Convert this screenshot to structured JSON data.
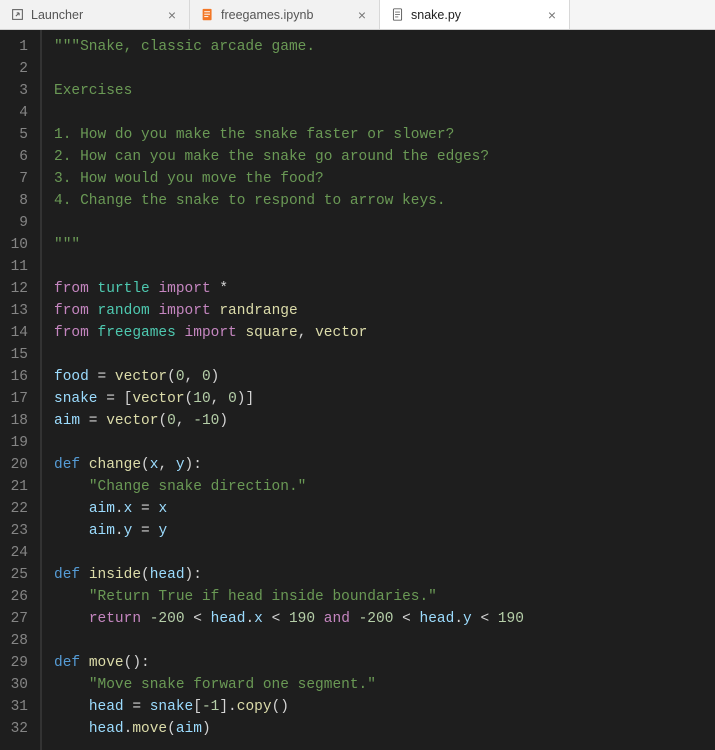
{
  "tabs": [
    {
      "icon": "launcher-icon",
      "label": "Launcher",
      "active": false
    },
    {
      "icon": "notebook-icon",
      "label": "freegames.ipynb",
      "active": false
    },
    {
      "icon": "python-file-icon",
      "label": "snake.py",
      "active": true
    }
  ],
  "editor": {
    "line_numbers": [
      "1",
      "2",
      "3",
      "4",
      "5",
      "6",
      "7",
      "8",
      "9",
      "10",
      "11",
      "12",
      "13",
      "14",
      "15",
      "16",
      "17",
      "18",
      "19",
      "20",
      "21",
      "22",
      "23",
      "24",
      "25",
      "26",
      "27",
      "28",
      "29",
      "30",
      "31",
      "32"
    ],
    "lines": [
      [
        {
          "t": "str",
          "v": "\"\"\"Snake, classic arcade game."
        }
      ],
      [],
      [
        {
          "t": "str",
          "v": "Exercises"
        }
      ],
      [],
      [
        {
          "t": "str",
          "v": "1. How do you make the snake faster or slower?"
        }
      ],
      [
        {
          "t": "str",
          "v": "2. How can you make the snake go around the edges?"
        }
      ],
      [
        {
          "t": "str",
          "v": "3. How would you move the food?"
        }
      ],
      [
        {
          "t": "str",
          "v": "4. Change the snake to respond to arrow keys."
        }
      ],
      [],
      [
        {
          "t": "str",
          "v": "\"\"\""
        }
      ],
      [],
      [
        {
          "t": "kw",
          "v": "from"
        },
        {
          "t": "op",
          "v": " "
        },
        {
          "t": "mod",
          "v": "turtle"
        },
        {
          "t": "op",
          "v": " "
        },
        {
          "t": "kw",
          "v": "import"
        },
        {
          "t": "op",
          "v": " *"
        }
      ],
      [
        {
          "t": "kw",
          "v": "from"
        },
        {
          "t": "op",
          "v": " "
        },
        {
          "t": "mod",
          "v": "random"
        },
        {
          "t": "op",
          "v": " "
        },
        {
          "t": "kw",
          "v": "import"
        },
        {
          "t": "op",
          "v": " "
        },
        {
          "t": "fn",
          "v": "randrange"
        }
      ],
      [
        {
          "t": "kw",
          "v": "from"
        },
        {
          "t": "op",
          "v": " "
        },
        {
          "t": "mod",
          "v": "freegames"
        },
        {
          "t": "op",
          "v": " "
        },
        {
          "t": "kw",
          "v": "import"
        },
        {
          "t": "op",
          "v": " "
        },
        {
          "t": "fn",
          "v": "square"
        },
        {
          "t": "op",
          "v": ", "
        },
        {
          "t": "fn",
          "v": "vector"
        }
      ],
      [],
      [
        {
          "t": "var",
          "v": "food"
        },
        {
          "t": "op",
          "v": " = "
        },
        {
          "t": "fn",
          "v": "vector"
        },
        {
          "t": "op",
          "v": "("
        },
        {
          "t": "num",
          "v": "0"
        },
        {
          "t": "op",
          "v": ", "
        },
        {
          "t": "num",
          "v": "0"
        },
        {
          "t": "op",
          "v": ")"
        }
      ],
      [
        {
          "t": "var",
          "v": "snake"
        },
        {
          "t": "op",
          "v": " = ["
        },
        {
          "t": "fn",
          "v": "vector"
        },
        {
          "t": "op",
          "v": "("
        },
        {
          "t": "num",
          "v": "10"
        },
        {
          "t": "op",
          "v": ", "
        },
        {
          "t": "num",
          "v": "0"
        },
        {
          "t": "op",
          "v": ")]"
        }
      ],
      [
        {
          "t": "var",
          "v": "aim"
        },
        {
          "t": "op",
          "v": " = "
        },
        {
          "t": "fn",
          "v": "vector"
        },
        {
          "t": "op",
          "v": "("
        },
        {
          "t": "num",
          "v": "0"
        },
        {
          "t": "op",
          "v": ", "
        },
        {
          "t": "num",
          "v": "-10"
        },
        {
          "t": "op",
          "v": ")"
        }
      ],
      [],
      [
        {
          "t": "blue",
          "v": "def"
        },
        {
          "t": "op",
          "v": " "
        },
        {
          "t": "fn",
          "v": "change"
        },
        {
          "t": "op",
          "v": "("
        },
        {
          "t": "var",
          "v": "x"
        },
        {
          "t": "op",
          "v": ", "
        },
        {
          "t": "var",
          "v": "y"
        },
        {
          "t": "op",
          "v": "):"
        }
      ],
      [
        {
          "t": "op",
          "v": "    "
        },
        {
          "t": "str",
          "v": "\"Change snake direction.\""
        }
      ],
      [
        {
          "t": "op",
          "v": "    "
        },
        {
          "t": "var",
          "v": "aim"
        },
        {
          "t": "op",
          "v": "."
        },
        {
          "t": "var",
          "v": "x"
        },
        {
          "t": "op",
          "v": " = "
        },
        {
          "t": "var",
          "v": "x"
        }
      ],
      [
        {
          "t": "op",
          "v": "    "
        },
        {
          "t": "var",
          "v": "aim"
        },
        {
          "t": "op",
          "v": "."
        },
        {
          "t": "var",
          "v": "y"
        },
        {
          "t": "op",
          "v": " = "
        },
        {
          "t": "var",
          "v": "y"
        }
      ],
      [],
      [
        {
          "t": "blue",
          "v": "def"
        },
        {
          "t": "op",
          "v": " "
        },
        {
          "t": "fn",
          "v": "inside"
        },
        {
          "t": "op",
          "v": "("
        },
        {
          "t": "var",
          "v": "head"
        },
        {
          "t": "op",
          "v": "):"
        }
      ],
      [
        {
          "t": "op",
          "v": "    "
        },
        {
          "t": "str",
          "v": "\"Return True if head inside boundaries.\""
        }
      ],
      [
        {
          "t": "op",
          "v": "    "
        },
        {
          "t": "kw",
          "v": "return"
        },
        {
          "t": "op",
          "v": " "
        },
        {
          "t": "num",
          "v": "-200"
        },
        {
          "t": "op",
          "v": " < "
        },
        {
          "t": "var",
          "v": "head"
        },
        {
          "t": "op",
          "v": "."
        },
        {
          "t": "var",
          "v": "x"
        },
        {
          "t": "op",
          "v": " < "
        },
        {
          "t": "num",
          "v": "190"
        },
        {
          "t": "op",
          "v": " "
        },
        {
          "t": "kw",
          "v": "and"
        },
        {
          "t": "op",
          "v": " "
        },
        {
          "t": "num",
          "v": "-200"
        },
        {
          "t": "op",
          "v": " < "
        },
        {
          "t": "var",
          "v": "head"
        },
        {
          "t": "op",
          "v": "."
        },
        {
          "t": "var",
          "v": "y"
        },
        {
          "t": "op",
          "v": " < "
        },
        {
          "t": "num",
          "v": "190"
        }
      ],
      [],
      [
        {
          "t": "blue",
          "v": "def"
        },
        {
          "t": "op",
          "v": " "
        },
        {
          "t": "fn",
          "v": "move"
        },
        {
          "t": "op",
          "v": "():"
        }
      ],
      [
        {
          "t": "op",
          "v": "    "
        },
        {
          "t": "str",
          "v": "\"Move snake forward one segment.\""
        }
      ],
      [
        {
          "t": "op",
          "v": "    "
        },
        {
          "t": "var",
          "v": "head"
        },
        {
          "t": "op",
          "v": " = "
        },
        {
          "t": "var",
          "v": "snake"
        },
        {
          "t": "op",
          "v": "["
        },
        {
          "t": "num",
          "v": "-1"
        },
        {
          "t": "op",
          "v": "]."
        },
        {
          "t": "fn",
          "v": "copy"
        },
        {
          "t": "op",
          "v": "()"
        }
      ],
      [
        {
          "t": "op",
          "v": "    "
        },
        {
          "t": "var",
          "v": "head"
        },
        {
          "t": "op",
          "v": "."
        },
        {
          "t": "fn",
          "v": "move"
        },
        {
          "t": "op",
          "v": "("
        },
        {
          "t": "var",
          "v": "aim"
        },
        {
          "t": "op",
          "v": ")"
        }
      ]
    ]
  },
  "colors": {
    "editor_bg": "#1e1e1e",
    "gutter_fg": "#858585",
    "tab_active_bg": "#ffffff",
    "tab_inactive_bg": "#f2f2f2"
  }
}
